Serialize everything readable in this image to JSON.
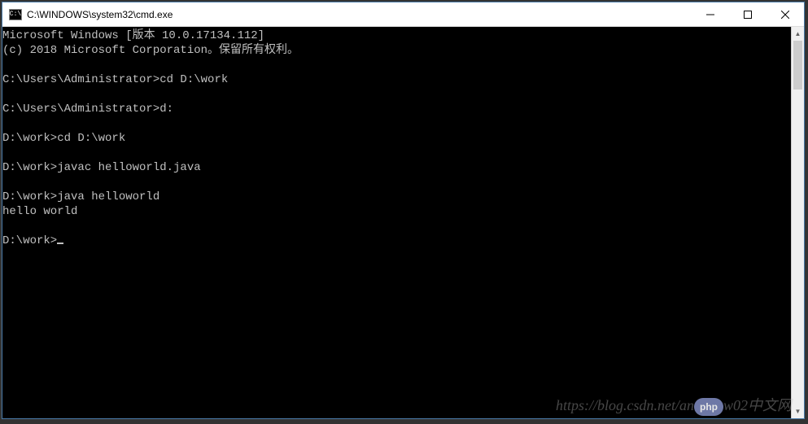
{
  "titlebar": {
    "icon_label": "C:\\",
    "title": "C:\\WINDOWS\\system32\\cmd.exe"
  },
  "console": {
    "lines": [
      "Microsoft Windows [版本 10.0.17134.112]",
      "(c) 2018 Microsoft Corporation。保留所有权利。",
      "",
      "C:\\Users\\Administrator>cd D:\\work",
      "",
      "C:\\Users\\Administrator>d:",
      "",
      "D:\\work>cd D:\\work",
      "",
      "D:\\work>javac helloworld.java",
      "",
      "D:\\work>java helloworld",
      "hello world",
      "",
      "D:\\work>"
    ]
  },
  "watermark": {
    "url_prefix": "https://blog.csdn.net/an",
    "logo_text": "php",
    "url_suffix": "w02中文网"
  }
}
